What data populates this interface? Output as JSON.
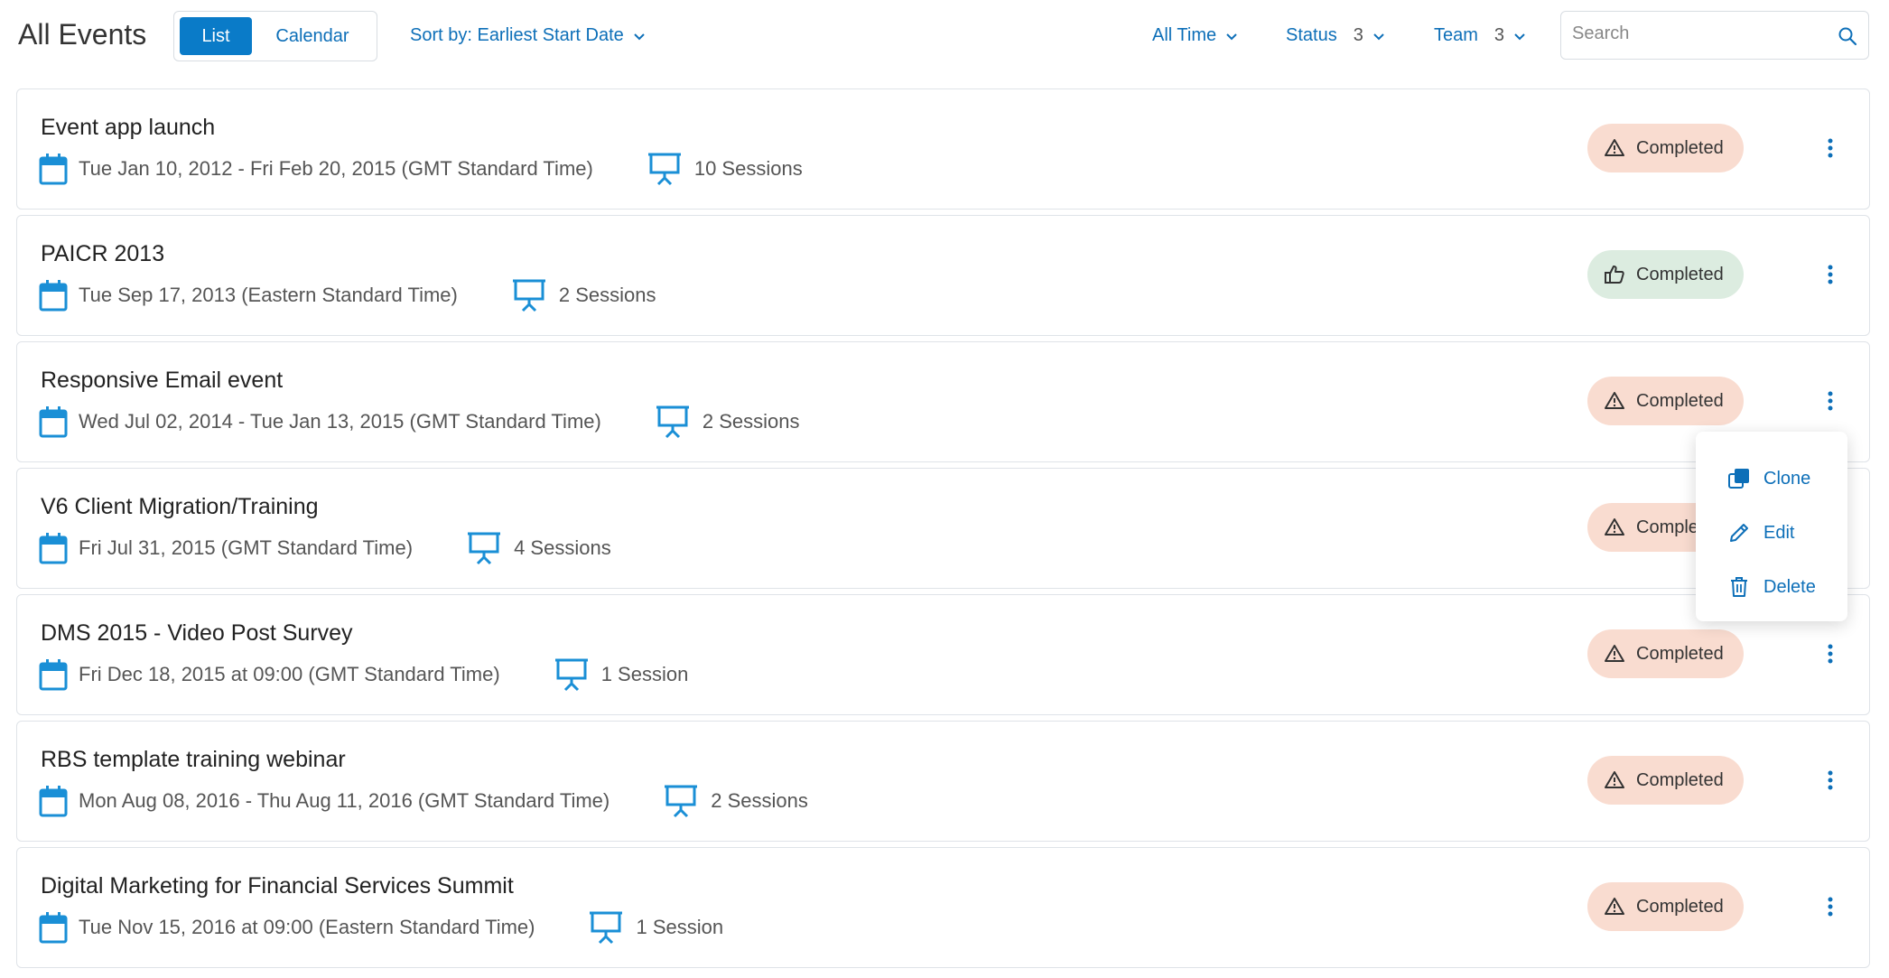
{
  "header": {
    "title": "All Events",
    "view_list": "List",
    "view_calendar": "Calendar",
    "sort_label": "Sort by: Earliest Start Date",
    "filter_time": "All Time",
    "filter_status": "Status",
    "filter_status_count": "3",
    "filter_team": "Team",
    "filter_team_count": "3",
    "search_placeholder": "Search"
  },
  "colors": {
    "accent": "#0a7bc8",
    "link": "#0d6fb8",
    "icon_blue": "#1a8fd6",
    "badge_warn_bg": "#f9dcd0",
    "badge_ok_bg": "#dcece0"
  },
  "events": [
    {
      "title": "Event app launch",
      "date": "Tue Jan 10, 2012 - Fri Feb 20, 2015 (GMT Standard Time)",
      "sessions": "10 Sessions",
      "status": "Completed",
      "status_icon": "warning-icon"
    },
    {
      "title": "PAICR 2013",
      "date": "Tue Sep 17, 2013 (Eastern Standard Time)",
      "sessions": "2 Sessions",
      "status": "Completed",
      "status_icon": "thumbs-up-icon"
    },
    {
      "title": "Responsive Email event",
      "date": "Wed Jul 02, 2014 - Tue Jan 13, 2015 (GMT Standard Time)",
      "sessions": "2 Sessions",
      "status": "Completed",
      "status_icon": "warning-icon"
    },
    {
      "title": "V6 Client Migration/Training",
      "date": "Fri Jul 31, 2015 (GMT Standard Time)",
      "sessions": "4 Sessions",
      "status": "Comple",
      "status_icon": "warning-icon"
    },
    {
      "title": "DMS 2015 - Video Post Survey",
      "date": "Fri Dec 18, 2015 at 09:00 (GMT Standard Time)",
      "sessions": "1 Session",
      "status": "Completed",
      "status_icon": "warning-icon"
    },
    {
      "title": "RBS template training webinar",
      "date": "Mon Aug 08, 2016 - Thu Aug 11, 2016 (GMT Standard Time)",
      "sessions": "2 Sessions",
      "status": "Completed",
      "status_icon": "warning-icon"
    },
    {
      "title": "Digital Marketing for Financial Services Summit",
      "date": "Tue Nov 15, 2016 at 09:00 (Eastern Standard Time)",
      "sessions": "1 Session",
      "status": "Completed",
      "status_icon": "warning-icon"
    }
  ],
  "menu": {
    "clone": "Clone",
    "edit": "Edit",
    "delete": "Delete"
  }
}
